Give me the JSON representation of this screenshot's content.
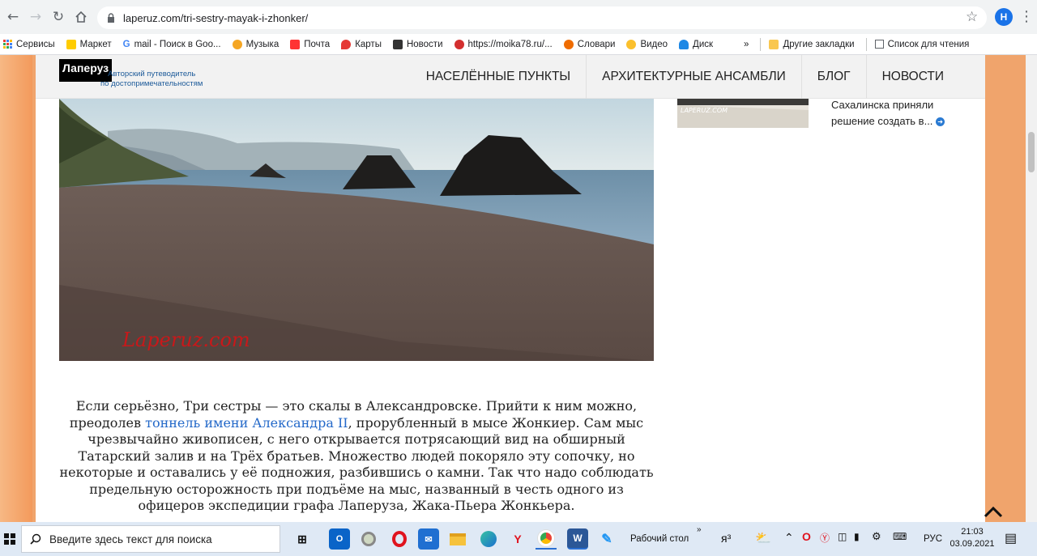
{
  "browser": {
    "url": "laperuz.com/tri-sestry-mayak-i-zhonker/",
    "profile_initial": "H",
    "bookmarks": [
      {
        "label": "Сервисы",
        "color": "#4285f4"
      },
      {
        "label": "Маркет",
        "color": "#fc0"
      },
      {
        "label": "mail - Поиск в Goo...",
        "color": "#4285f4"
      },
      {
        "label": "Музыка",
        "color": "#f5a623"
      },
      {
        "label": "Почта",
        "color": "#f33"
      },
      {
        "label": "Карты",
        "color": "#e53935"
      },
      {
        "label": "Новости",
        "color": "#333"
      },
      {
        "label": "https://moika78.ru/...",
        "color": "#d32f2f"
      },
      {
        "label": "Словари",
        "color": "#ef6c00"
      },
      {
        "label": "Видео",
        "color": "#fbc02d"
      },
      {
        "label": "Диск",
        "color": "#1e88e5"
      }
    ],
    "overflow": "»",
    "other_bookmarks": "Другие закладки",
    "reading_list": "Список для чтения"
  },
  "site": {
    "logo": "Лаперуз",
    "tagline_line1": "Авторский путеводитель",
    "tagline_line2": "по достопримечательностям",
    "nav": [
      "НАСЕЛЁННЫЕ ПУНКТЫ",
      "АРХИТЕКТУРНЫЕ АНСАМБЛИ",
      "БЛОГ",
      "НОВОСТИ"
    ]
  },
  "hero": {
    "watermark": "Laperuz.com"
  },
  "sidebar": {
    "thumb_watermark": "LAPERUZ.COM",
    "line1": "Сахалинска приняли",
    "line2": "решение создать в..."
  },
  "article": {
    "p1_before_link": "Если серьёзно, Три сестры — это скалы в Александровске. Прийти к ним можно, преодолев ",
    "link": "тоннель имени Александра II",
    "p1_after_link": ", прорубленный в мысе Жонкиер. Сам мыс чрезвычайно живописен, с него открывается потрясающий вид на обширный Татарский залив и на Трёх братьев. Множество людей покоряло эту сопочку, но некоторые и оставались у её подножия, разбившись о камни. Так что надо соблюдать предельную осторожность при подъёме на мыс, названный в честь одного из офицеров экспедиции графа Лаперуза, Жака-Пьера Жонкьера."
  },
  "taskbar": {
    "search_placeholder": "Введите здесь текст для поиска",
    "desktop_label": "Рабочий стол",
    "lang": "РУС",
    "time": "21:03",
    "date": "03.09.2021"
  }
}
